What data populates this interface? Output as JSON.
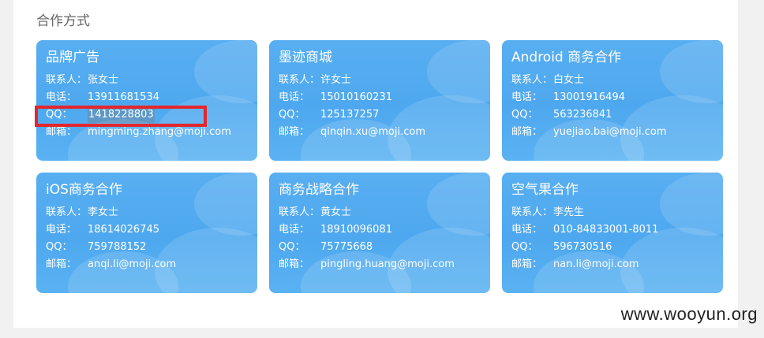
{
  "section_title": "合作方式",
  "labels": {
    "contact": "联系人：",
    "phone": "电话：",
    "qq": "QQ：",
    "email": "邮箱："
  },
  "cards": [
    {
      "title": "品牌广告",
      "contact": "张女士",
      "phone": "13911681534",
      "qq": "1418228803",
      "email": "mingming.zhang@moji.com"
    },
    {
      "title": "墨迹商城",
      "contact": "许女士",
      "phone": "15010160231",
      "qq": "125137257",
      "email": "qinqin.xu@moji.com"
    },
    {
      "title": "Android 商务合作",
      "contact": "白女士",
      "phone": "13001916494",
      "qq": "563236841",
      "email": "yuejiao.bai@moji.com"
    },
    {
      "title": "iOS商务合作",
      "contact": "李女士",
      "phone": "18614026745",
      "qq": "759788152",
      "email": "anqi.li@moji.com"
    },
    {
      "title": "商务战略合作",
      "contact": "黄女士",
      "phone": "18910096081",
      "qq": "75775668",
      "email": "pingling.huang@moji.com"
    },
    {
      "title": "空气果合作",
      "contact": "李先生",
      "phone": "010-84833001-8011",
      "qq": "596730516",
      "email": "nan.li@moji.com"
    }
  ],
  "watermark": "www.wooyun.org",
  "colors": {
    "card_bg": "#4ea8ef",
    "highlight_box": "#e3262b",
    "title_text": "#666666"
  }
}
